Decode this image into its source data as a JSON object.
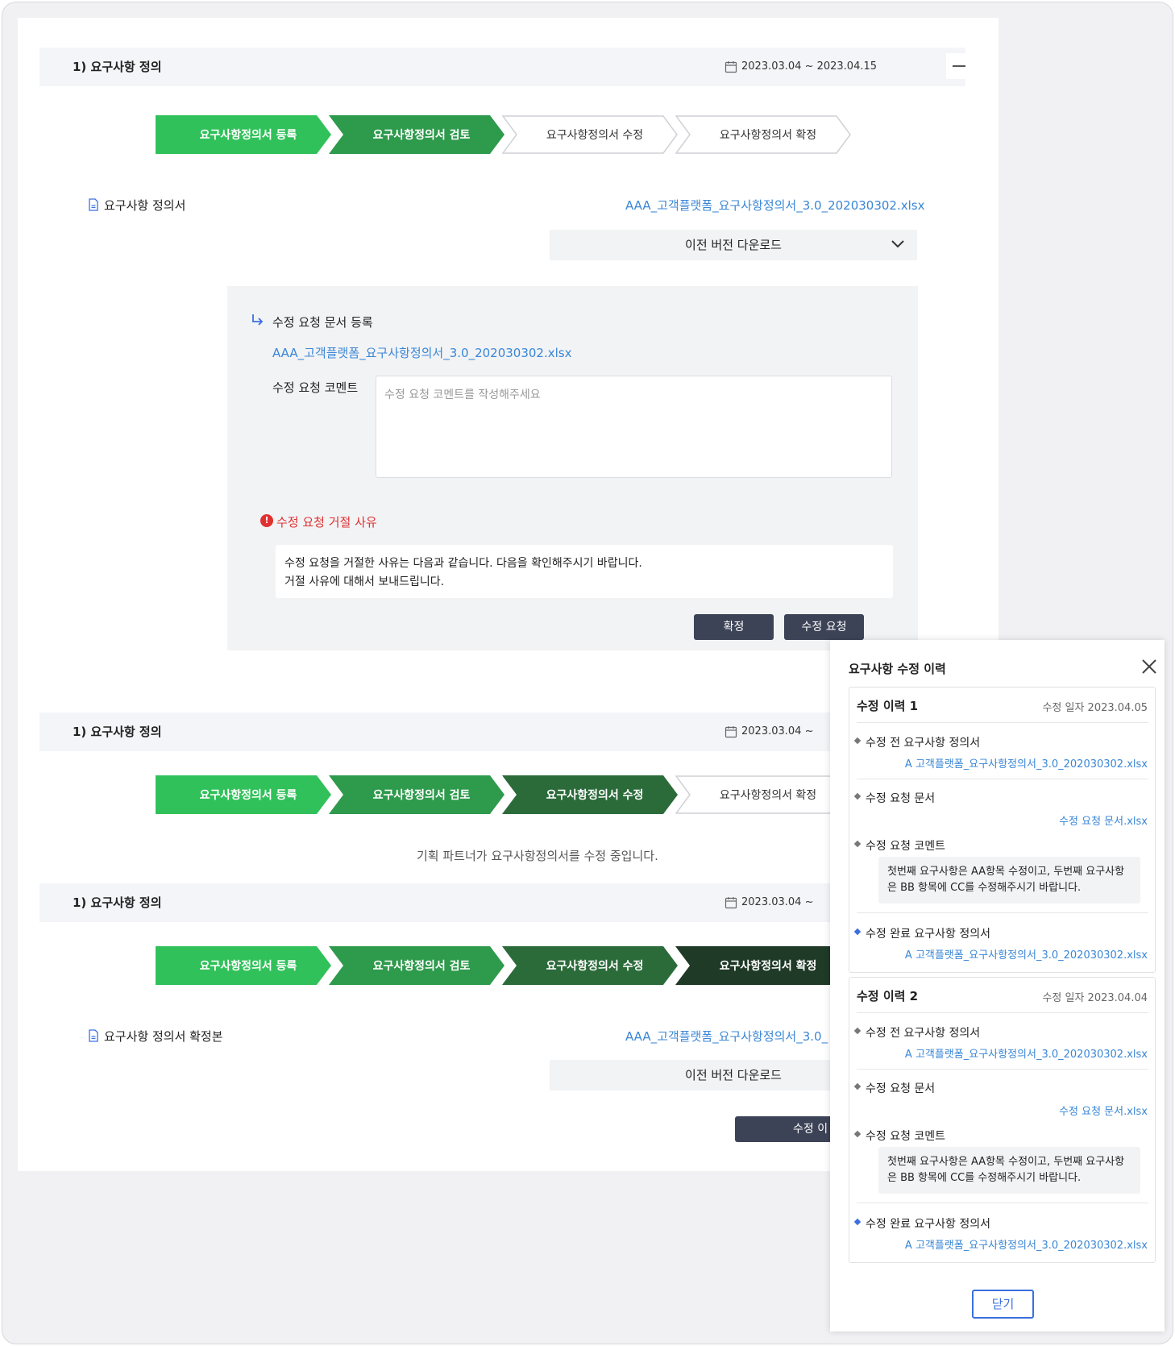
{
  "sections": [
    {
      "title": "1) 요구사항 정의",
      "date_range": "2023.03.04 ~ 2023.04.15",
      "steps": [
        "요구사항정의서 등록",
        "요구사항정의서 검토",
        "요구사항정의서 수정",
        "요구사항정의서 확정"
      ],
      "doc_label": "요구사항 정의서",
      "doc_file": "AAA_고객플랫폼_요구사항정의서_3.0_202030302.xlsx",
      "download_label": "이전 버전 다운로드"
    },
    {
      "title": "1) 요구사항 정의",
      "date_range": "2023.03.04 ~",
      "steps": [
        "요구사항정의서 등록",
        "요구사항정의서 검토",
        "요구사항정의서 수정",
        "요구사항정의서 확정"
      ],
      "status_text": "기획 파트너가 요구사항정의서를 수정 중입니다."
    },
    {
      "title": "1) 요구사항 정의",
      "date_range": "2023.03.04 ~",
      "steps": [
        "요구사항정의서 등록",
        "요구사항정의서 검토",
        "요구사항정의서 수정",
        "요구사항정의서 확정"
      ],
      "doc_label": "요구사항 정의서 확정본",
      "doc_file": "AAA_고객플랫폼_요구사항정의서_3.0_",
      "download_label": "이전 버전 다운로드",
      "history_button": "수정 이"
    }
  ],
  "request": {
    "title": "수정 요청 문서 등록",
    "file": "AAA_고객플랫폼_요구사항정의서_3.0_202030302.xlsx",
    "comment_label": "수정 요청 코멘트",
    "comment_placeholder": "수정 요청 코멘트를 작성해주세요",
    "reject_title": "수정 요청 거절 사유",
    "reject_icon": "!",
    "reject_line1": "수정 요청을 거절한 사유는 다음과 같습니다. 다음을 확인해주시기 바랍니다.",
    "reject_line2": "거절 사유에 대해서 보내드립니다.",
    "confirm_button": "확정",
    "request_button": "수정 요청"
  },
  "modal": {
    "title": "요구사항 수정 이력",
    "close_button": "닫기",
    "histories": [
      {
        "title": "수정 이력 1",
        "date": "수정 일자 2023.04.05",
        "before_label": "수정 전 요구사항 정의서",
        "before_file": "A 고객플랫폼_요구사항정의서_3.0_202030302.xlsx",
        "req_doc_label": "수정 요청 문서",
        "req_doc_file": "수정 요청 문서.xlsx",
        "comment_label": "수정 요청 코멘트",
        "comment_line1": "첫번째 요구사항은 AA항목 수정이고, 두번째 요구사항",
        "comment_line2": "은 BB 항목에 CC를 수정해주시기 바랍니다.",
        "done_label": "수정 완료 요구사항 정의서",
        "done_file": "A 고객플랫폼_요구사항정의서_3.0_202030302.xlsx"
      },
      {
        "title": "수정 이력 2",
        "date": "수정 일자 2023.04.04",
        "before_label": "수정 전 요구사항 정의서",
        "before_file": "A 고객플랫폼_요구사항정의서_3.0_202030302.xlsx",
        "req_doc_label": "수정 요청 문서",
        "req_doc_file": "수정 요청 문서.xlsx",
        "comment_label": "수정 요청 코멘트",
        "comment_line1": "첫번째 요구사항은 AA항목 수정이고, 두번째 요구사항",
        "comment_line2": "은 BB 항목에 CC를 수정해주시기 바랍니다.",
        "done_label": "수정 완료 요구사항 정의서",
        "done_file": "A 고객플랫폼_요구사항정의서_3.0_202030302.xlsx"
      }
    ]
  },
  "colors": {
    "step_register": "#31c15a",
    "step_review": "#2e9a4c",
    "step_edit": "#2b6b3a",
    "step_confirm": "#1f3a27",
    "link": "#3a86d6",
    "danger": "#e03131",
    "dark_button": "#3d4357",
    "modal_accent": "#3b6fe0"
  }
}
